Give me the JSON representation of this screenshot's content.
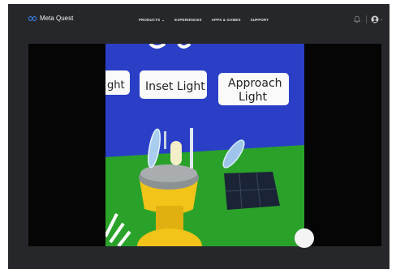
{
  "brand": {
    "name": "Meta Quest",
    "logo_icon": "meta-infinity-icon"
  },
  "nav": {
    "items": [
      {
        "label": "PRODUCTS",
        "has_dropdown": true
      },
      {
        "label": "EXPERIENCES",
        "has_dropdown": false
      },
      {
        "label": "APPS & GAMES",
        "has_dropdown": false
      },
      {
        "label": "SUPPORT",
        "has_dropdown": false
      }
    ],
    "icons": [
      "notification-bell-icon",
      "account-avatar-icon",
      "chevron-down-icon"
    ]
  },
  "video": {
    "scene_signs": {
      "left": "ght",
      "center": "Inset Light",
      "right_line1": "Approach",
      "right_line2": "Light"
    }
  },
  "colors": {
    "page_bg": "#ffffff",
    "frame_bg": "#26272b",
    "player_bg": "#050505",
    "sky": "#2a3fc6",
    "ground": "#2aa22a",
    "fixture_yellow": "#f2c318"
  }
}
